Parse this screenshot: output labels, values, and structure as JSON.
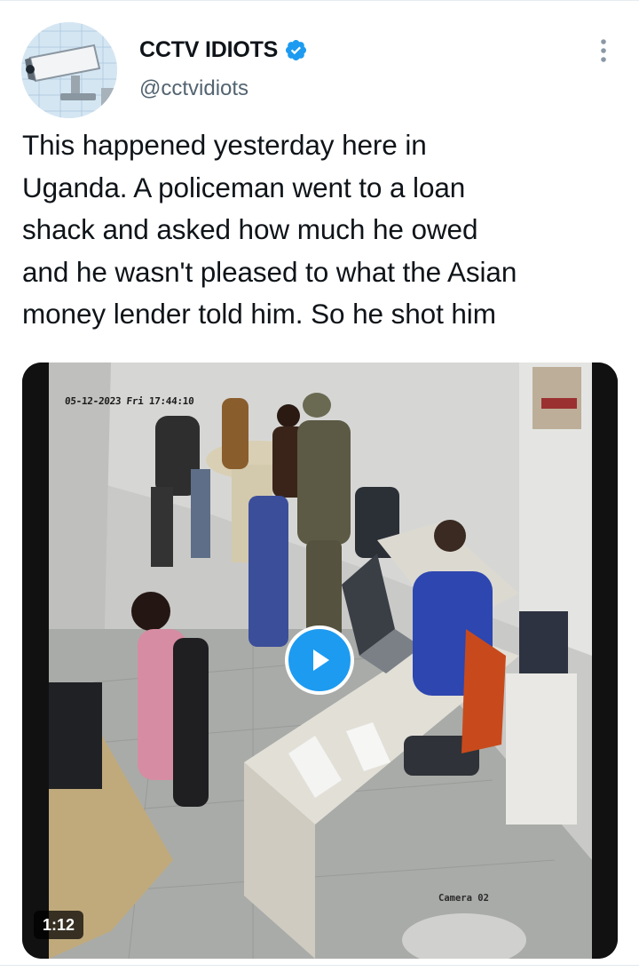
{
  "account": {
    "display_name": "CCTV IDIOTS",
    "handle": "@cctvidiots",
    "verified": true
  },
  "tweet": {
    "lines": [
      "This happened yesterday here in",
      "Uganda. A policeman went to a loan",
      "shack and asked how much he owed",
      "and he wasn't pleased to what the Asian",
      "money lender told him. So he shot him"
    ]
  },
  "video": {
    "timestamp_overlay": "05-12-2023 Fri 17:44:10",
    "camera_label": "Camera 02",
    "duration": "1:12"
  },
  "icons": {
    "avatar": "security-camera-avatar-icon",
    "verified": "verified-badge-icon",
    "more": "more-options-icon",
    "play": "play-icon"
  },
  "colors": {
    "accent": "#1d9bf0",
    "text_primary": "#0f1419",
    "text_secondary": "#536471"
  }
}
